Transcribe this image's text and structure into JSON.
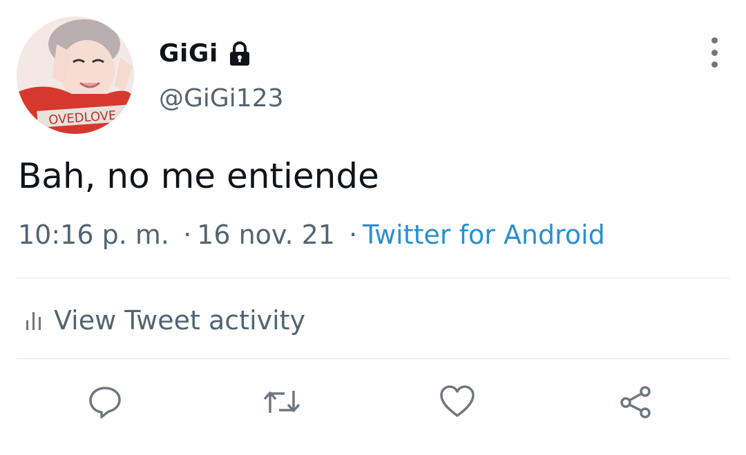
{
  "tweet": {
    "author": {
      "display_name": "GiGi",
      "handle": "@GiGi123",
      "protected_icon": "lock-icon",
      "avatar_text": "OVEDLOVE"
    },
    "text": "Bah, no me entiende",
    "timestamp": "10:16 p. m.",
    "date": "16 nov. 21",
    "separator": "·",
    "source": "Twitter for Android",
    "activity_label": "View Tweet activity"
  },
  "actions": [
    {
      "name": "reply",
      "icon": "reply-icon"
    },
    {
      "name": "retweet",
      "icon": "retweet-icon"
    },
    {
      "name": "like",
      "icon": "heart-icon"
    },
    {
      "name": "share",
      "icon": "share-icon"
    }
  ],
  "colors": {
    "text_primary": "#0f1419",
    "text_secondary": "#536471",
    "link": "#2b8fd3",
    "divider": "#dfe3e6",
    "icon": "#6e7681"
  }
}
